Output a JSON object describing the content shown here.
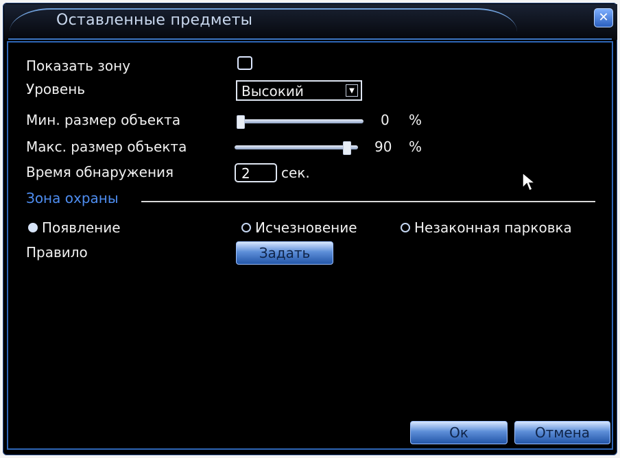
{
  "dialog": {
    "title": "Оставленные предметы",
    "close_icon": "close-icon"
  },
  "settings": {
    "show_zone_label": "Показать зону",
    "show_zone_checked": false,
    "level_label": "Уровень",
    "level_value": "Высокий",
    "min_size_label": "Мин. размер объекта",
    "min_size_value": "0",
    "min_size_unit": "%",
    "max_size_label": "Макс. размер объекта",
    "max_size_value": "90",
    "max_size_unit": "%",
    "detect_time_label": "Время обнаружения",
    "detect_time_value": "2",
    "detect_time_unit": "сек."
  },
  "zone": {
    "section_title": "Зона охраны",
    "options": [
      {
        "label": "Появление",
        "selected": true
      },
      {
        "label": "Исчезновение",
        "selected": false
      },
      {
        "label": "Незаконная парковка",
        "selected": false
      }
    ],
    "rule_label": "Правило",
    "rule_button": "Задать"
  },
  "footer": {
    "ok_label": "Ок",
    "cancel_label": "Отмена"
  }
}
